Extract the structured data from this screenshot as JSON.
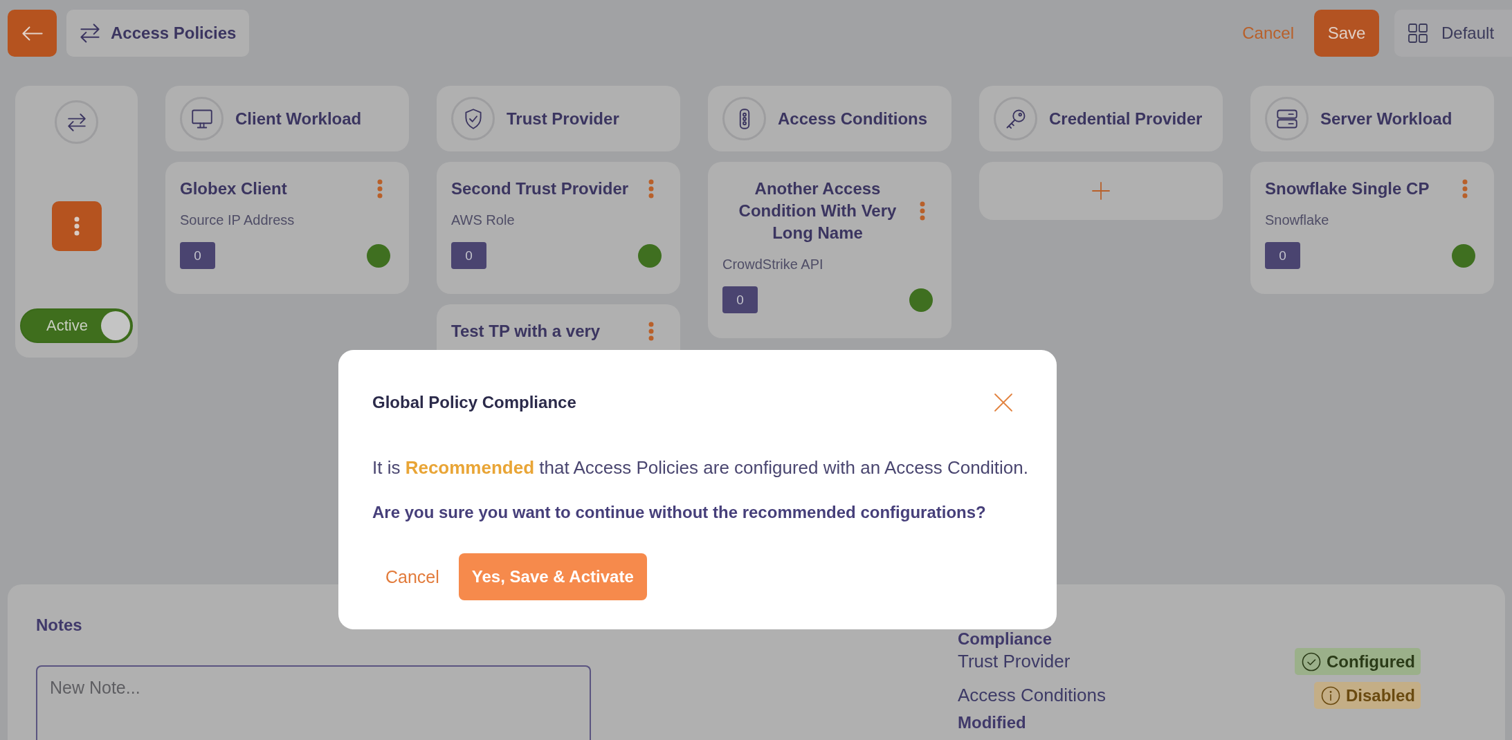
{
  "header": {
    "title": "Access Policies",
    "cancel": "Cancel",
    "save": "Save",
    "layout": "Default"
  },
  "policy": {
    "status_label": "Active",
    "active": true
  },
  "columns": [
    {
      "title": "Client Workload",
      "kind": "client",
      "items": [
        {
          "name": "Globex Client",
          "type": "Source IP Address",
          "count": "0",
          "color": "#3f6f20"
        }
      ]
    },
    {
      "title": "Trust Provider",
      "kind": "trust",
      "items": [
        {
          "name": "Second Trust Provider",
          "type": "AWS Role",
          "count": "0",
          "color": "#3f6f20"
        },
        {
          "name": "Test TP with a very"
        }
      ]
    },
    {
      "title": "Access Conditions",
      "kind": "condition",
      "items": [
        {
          "name": "Another Access Condition With Very Long Name",
          "type": "CrowdStrike API",
          "count": "0",
          "color": "#3f6f20"
        }
      ]
    },
    {
      "title": "Credential Provider",
      "kind": "credential"
    },
    {
      "title": "Server Workload",
      "kind": "server",
      "items": [
        {
          "name": "Snowflake Single CP",
          "type": "Snowflake",
          "count": "0",
          "color": "#3f6f20"
        }
      ]
    }
  ],
  "notes": {
    "title": "Notes",
    "placeholder": "New Note..."
  },
  "compliance": {
    "title": "Compliance",
    "rows": [
      {
        "label": "Trust Provider",
        "status": "Configured",
        "kind": "configured"
      },
      {
        "label": "Access Conditions",
        "status": "Disabled",
        "kind": "disabled"
      }
    ]
  },
  "modified": {
    "title": "Modified"
  },
  "dialog": {
    "title": "Global Policy Compliance",
    "message": "It is **Recommended** that Access Policies are configured with an Access Condition.",
    "question": "Are you sure you want to continue without the recommended configurations?",
    "cancel": "Cancel",
    "confirm": "Yes, Save & Activate"
  }
}
